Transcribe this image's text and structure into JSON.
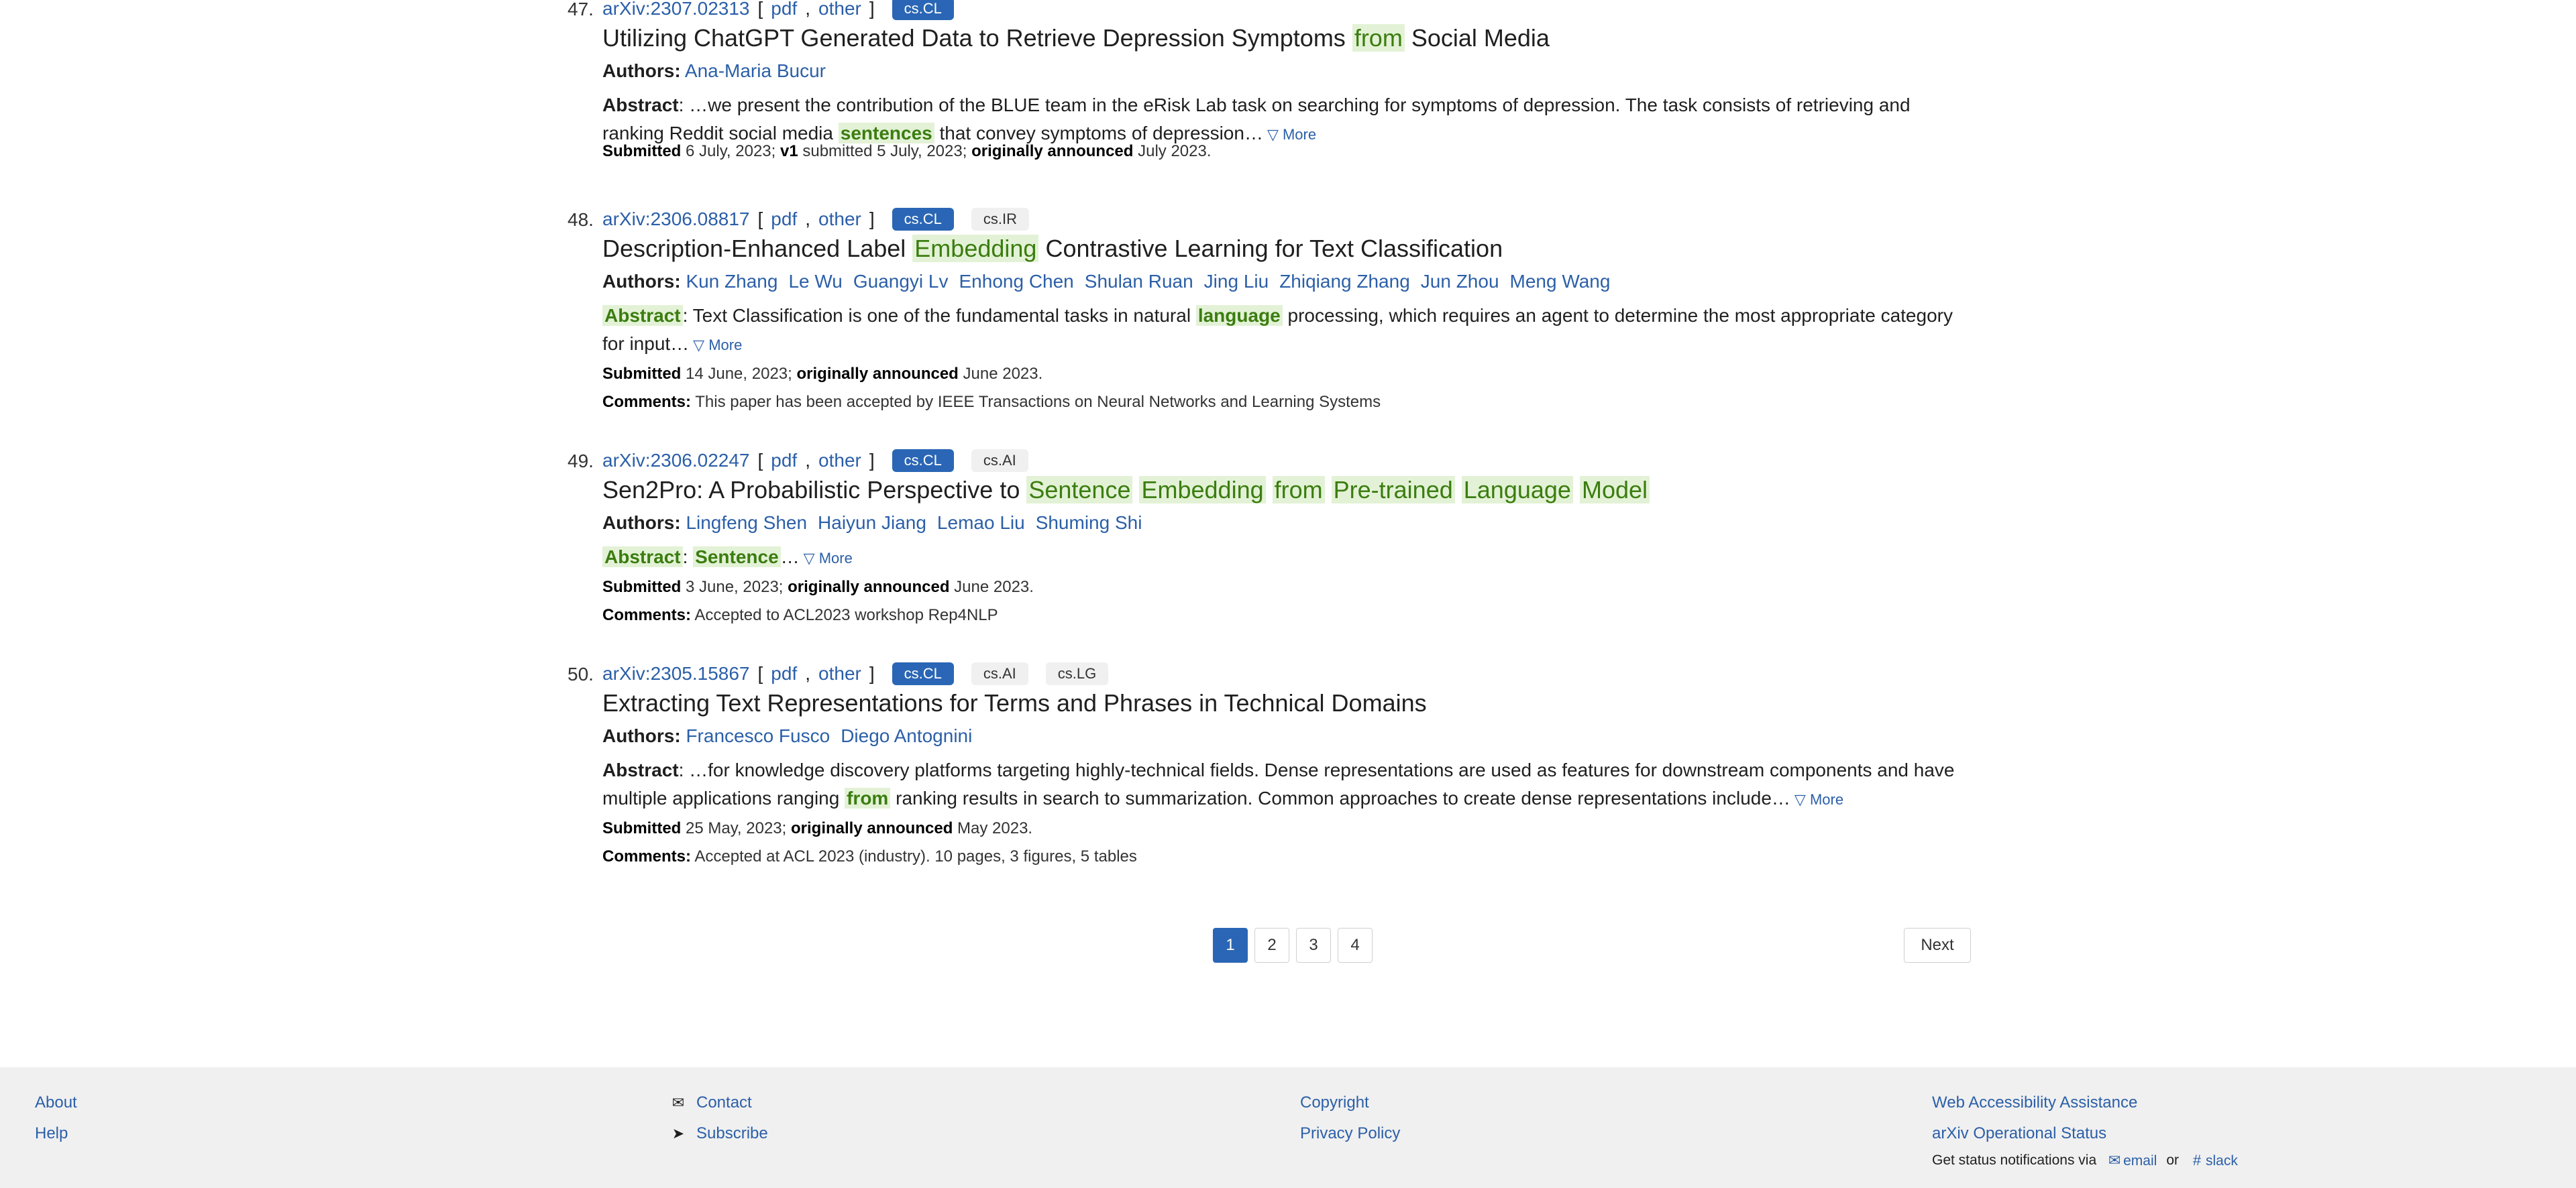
{
  "results": [
    {
      "number": "47.",
      "id": "arXiv:2307.02313",
      "pdf": "pdf",
      "other": "other",
      "tags": [
        "cs.CL"
      ],
      "title_segments": [
        {
          "text": "Utilizing ChatGPT Generated Data to Retrieve Depression Symptoms ",
          "hl": false
        },
        {
          "text": "from",
          "hl": true
        },
        {
          "text": " Social Media",
          "hl": false
        }
      ],
      "authors_label": "Authors:",
      "authors": [
        "Ana-Maria Bucur"
      ],
      "abstract_label": "Abstract",
      "abstract_segments": [
        {
          "text": ": …we present the contribution of the BLUE team in the eRisk Lab task on searching for symptoms of depression. The task consists of retrieving and ranking Reddit social media ",
          "hl": false
        },
        {
          "text": "sentences",
          "hl": true
        },
        {
          "text": " that convey symptoms of depression…",
          "hl": false
        }
      ],
      "more": "▽ More",
      "submitted_label": "Submitted",
      "submitted": "6 July, 2023;",
      "v1_label": "v1",
      "v1_text": "submitted 5 July, 2023;",
      "announced_label": "originally announced",
      "announced": "July 2023.",
      "comments_label": "",
      "comments": ""
    },
    {
      "number": "48.",
      "id": "arXiv:2306.08817",
      "pdf": "pdf",
      "other": "other",
      "tags": [
        "cs.CL",
        "cs.IR"
      ],
      "title_segments": [
        {
          "text": "Description-Enhanced Label ",
          "hl": false
        },
        {
          "text": "Embedding",
          "hl": true
        },
        {
          "text": " Contrastive Learning for Text Classification",
          "hl": false
        }
      ],
      "authors_label": "Authors:",
      "authors": [
        "Kun Zhang",
        "Le Wu",
        "Guangyi Lv",
        "Enhong Chen",
        "Shulan Ruan",
        "Jing Liu",
        "Zhiqiang Zhang",
        "Jun Zhou",
        "Meng Wang"
      ],
      "abstract_label": "Abstract",
      "abstract_label_hl": true,
      "abstract_segments": [
        {
          "text": ": Text Classification is one of the fundamental tasks in natural ",
          "hl": false
        },
        {
          "text": "language",
          "hl": true
        },
        {
          "text": " processing, which requires an agent to determine the most appropriate category for input…",
          "hl": false
        }
      ],
      "more": "▽ More",
      "submitted_label": "Submitted",
      "submitted": "14 June, 2023;",
      "announced_label": "originally announced",
      "announced": "June 2023.",
      "comments_label": "Comments:",
      "comments": "This paper has been accepted by IEEE Transactions on Neural Networks and Learning Systems"
    },
    {
      "number": "49.",
      "id": "arXiv:2306.02247",
      "pdf": "pdf",
      "other": "other",
      "tags": [
        "cs.CL",
        "cs.AI"
      ],
      "title_segments": [
        {
          "text": "Sen2Pro: A Probabilistic Perspective to ",
          "hl": false
        },
        {
          "text": "Sentence",
          "hl": true
        },
        {
          "text": " ",
          "hl": false
        },
        {
          "text": "Embedding",
          "hl": true
        },
        {
          "text": " ",
          "hl": false
        },
        {
          "text": "from",
          "hl": true
        },
        {
          "text": " ",
          "hl": false
        },
        {
          "text": "Pre-trained",
          "hl": true
        },
        {
          "text": " ",
          "hl": false
        },
        {
          "text": "Language",
          "hl": true
        },
        {
          "text": " ",
          "hl": false
        },
        {
          "text": "Model",
          "hl": true
        }
      ],
      "authors_label": "Authors:",
      "authors": [
        "Lingfeng Shen",
        "Haiyun Jiang",
        "Lemao Liu",
        "Shuming Shi"
      ],
      "abstract_label": "Abstract",
      "abstract_label_hl": true,
      "abstract_segments": [
        {
          "text": ": ",
          "hl": false
        },
        {
          "text": "Sentence",
          "hl": true
        },
        {
          "text": "…",
          "hl": false
        }
      ],
      "more": "▽ More",
      "submitted_label": "Submitted",
      "submitted": "3 June, 2023;",
      "announced_label": "originally announced",
      "announced": "June 2023.",
      "comments_label": "Comments:",
      "comments": "Accepted to ACL2023 workshop Rep4NLP"
    },
    {
      "number": "50.",
      "id": "arXiv:2305.15867",
      "pdf": "pdf",
      "other": "other",
      "tags": [
        "cs.CL",
        "cs.AI",
        "cs.LG"
      ],
      "title_segments": [
        {
          "text": "Extracting Text Representations for Terms and Phrases in Technical Domains",
          "hl": false
        }
      ],
      "authors_label": "Authors:",
      "authors": [
        "Francesco Fusco",
        "Diego Antognini"
      ],
      "abstract_label": "Abstract",
      "abstract_segments": [
        {
          "text": ": …for knowledge discovery platforms targeting highly-technical fields. Dense representations are used as features for downstream components and have multiple applications ranging ",
          "hl": false
        },
        {
          "text": "from",
          "hl": true
        },
        {
          "text": " ranking results in search to summarization. Common approaches to create dense representations include…",
          "hl": false
        }
      ],
      "more": "▽ More",
      "submitted_label": "Submitted",
      "submitted": "25 May, 2023;",
      "announced_label": "originally announced",
      "announced": "May 2023.",
      "comments_label": "Comments:",
      "comments": "Accepted at ACL 2023 (industry). 10 pages, 3 figures, 5 tables"
    }
  ],
  "pagination": {
    "pages": [
      "1",
      "2",
      "3",
      "4"
    ],
    "current": "1",
    "next_label": "Next"
  },
  "footer": {
    "about": "About",
    "help": "Help",
    "contact": "Contact",
    "subscribe": "Subscribe",
    "copyright": "Copyright",
    "privacy": "Privacy Policy",
    "accessibility": "Web Accessibility Assistance",
    "status": "arXiv Operational Status",
    "notify_text": "Get status notifications via",
    "email": "email",
    "or_text": "or",
    "slack": "slack",
    "icons": {
      "contact": "envelope-icon",
      "subscribe": "paper-plane-icon",
      "email": "envelope-icon",
      "slack": "slack-icon"
    }
  }
}
